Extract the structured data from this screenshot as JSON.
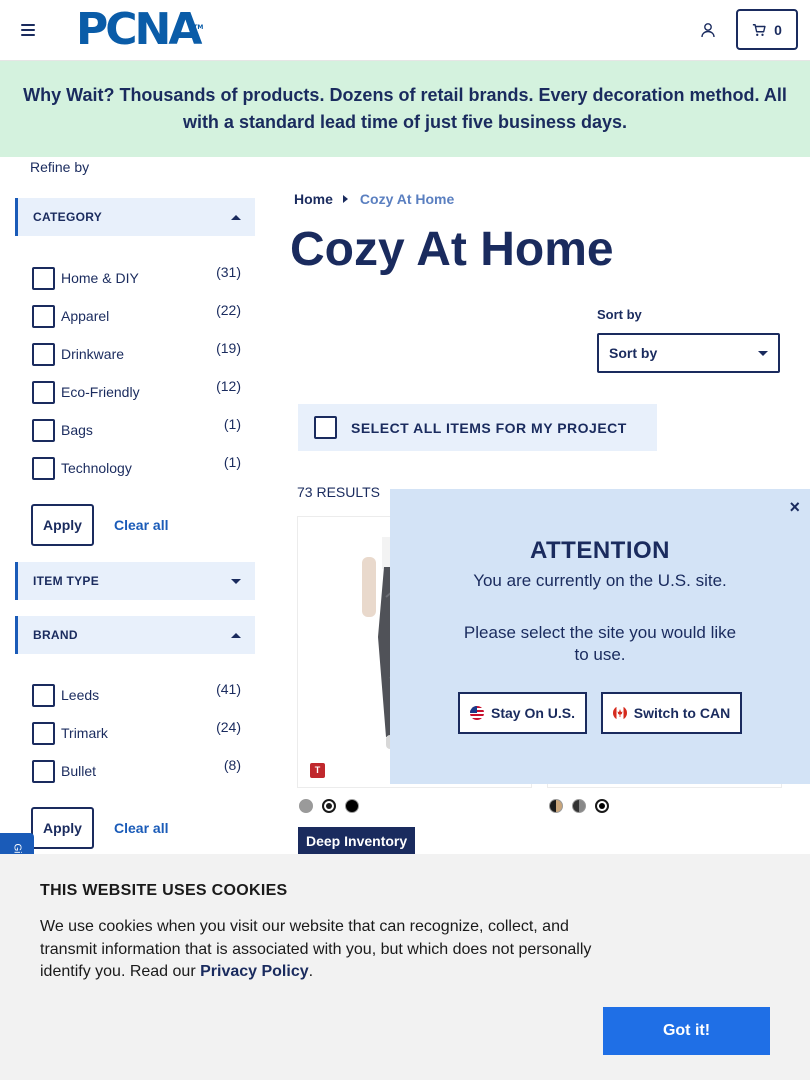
{
  "header": {
    "logo_text": "PCNA",
    "logo_tm": "TM",
    "cart_count": "0"
  },
  "banner": {
    "text": "Why Wait? Thousands of products. Dozens of retail brands. Every decoration method. All with a standard lead time of just five business days."
  },
  "sidebar": {
    "refine_label": "Refine by",
    "category": {
      "title": "CATEGORY",
      "options": [
        {
          "label": "Home & DIY",
          "count": "(31)"
        },
        {
          "label": "Apparel",
          "count": "(22)"
        },
        {
          "label": "Drinkware",
          "count": "(19)"
        },
        {
          "label": "Eco-Friendly",
          "count": "(12)"
        },
        {
          "label": "Bags",
          "count": "(1)"
        },
        {
          "label": "Technology",
          "count": "(1)"
        }
      ],
      "apply_label": "Apply",
      "clear_label": "Clear all"
    },
    "item_type": {
      "title": "ITEM TYPE"
    },
    "brand": {
      "title": "BRAND",
      "options": [
        {
          "label": "Leeds",
          "count": "(41)"
        },
        {
          "label": "Trimark",
          "count": "(24)"
        },
        {
          "label": "Bullet",
          "count": "(8)"
        }
      ],
      "apply_label": "Apply",
      "clear_label": "Clear all"
    },
    "side_tab_text": "Gi"
  },
  "main": {
    "breadcrumb": {
      "home": "Home",
      "current": "Cozy At Home"
    },
    "title": "Cozy At Home",
    "sort": {
      "label": "Sort by",
      "selected": "Sort by"
    },
    "select_all_label": "SELECT ALL ITEMS FOR MY PROJECT",
    "results_count": "73 RESULTS",
    "products": [
      {
        "brand_badge": "T",
        "swatches": [
          "#9a9a9a",
          "#1a1a1a",
          "#000000"
        ],
        "inventory": "Deep Inventory"
      },
      {
        "swatches": [
          "#c9a57a",
          "#555555",
          "#000000"
        ]
      }
    ]
  },
  "modal": {
    "close": "×",
    "title": "ATTENTION",
    "line1": "You are currently on the U.S. site.",
    "line2": "Please select the site you would like to use.",
    "stay_label": "Stay On U.S.",
    "switch_label": "Switch to CAN"
  },
  "cookie": {
    "title": "THIS WEBSITE USES COOKIES",
    "body": "We use cookies when you visit our website that can recognize, collect, and transmit information that is associated with you, but which does not personally identify you. Read our ",
    "link": "Privacy Policy",
    "end": ".",
    "button": "Got it!"
  },
  "colors": {
    "navy": "#1a2b5e",
    "brand_blue": "#0a5ca8",
    "banner_bg": "#d4f2de",
    "modal_bg": "#d3e3f6",
    "accept_blue": "#1f6fe6"
  }
}
